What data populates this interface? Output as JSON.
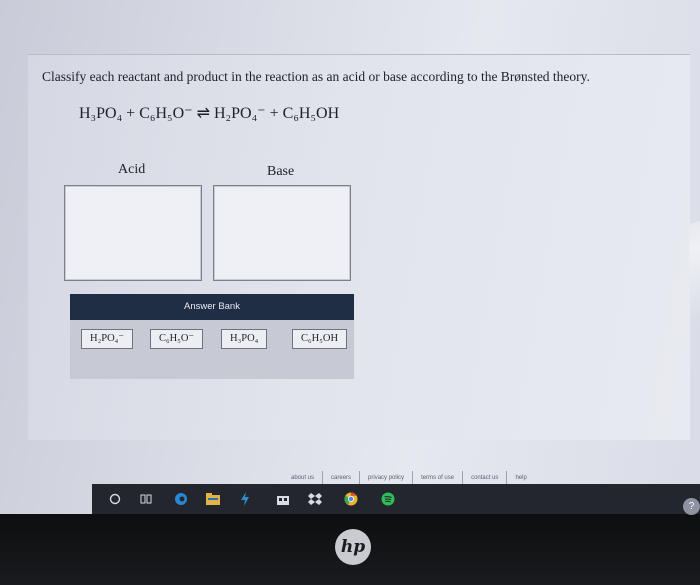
{
  "question": {
    "prompt": "Classify each reactant and product in the reaction as an acid or base according to the Brønsted theory.",
    "equation": {
      "r1": "H₃PO₄",
      "plus1": "+",
      "r2": "C₆H₅O⁻",
      "arrow": "⇌",
      "p1": "H₂PO₄⁻",
      "plus2": "+",
      "p2": "C₆H₅OH"
    }
  },
  "zones": {
    "acid_label": "Acid",
    "base_label": "Base"
  },
  "answer_bank": {
    "title": "Answer Bank",
    "tiles": [
      "H₂PO₄⁻",
      "C₆H₅O⁻",
      "H₃PO₄",
      "C₆H₅OH"
    ]
  },
  "footer": {
    "links": [
      "about us",
      "careers",
      "privacy policy",
      "terms of use",
      "contact us",
      "help"
    ]
  },
  "taskbar": {
    "icons": [
      "cortana-icon",
      "task-view-icon",
      "edge-icon",
      "file-explorer-icon",
      "app-icon",
      "store-icon",
      "dropbox-icon",
      "chrome-icon",
      "spotify-icon"
    ]
  },
  "brand": {
    "logo_text": "hp"
  },
  "colors": {
    "bank_header": "#1f2d45",
    "panel": "#e2e4ec"
  }
}
